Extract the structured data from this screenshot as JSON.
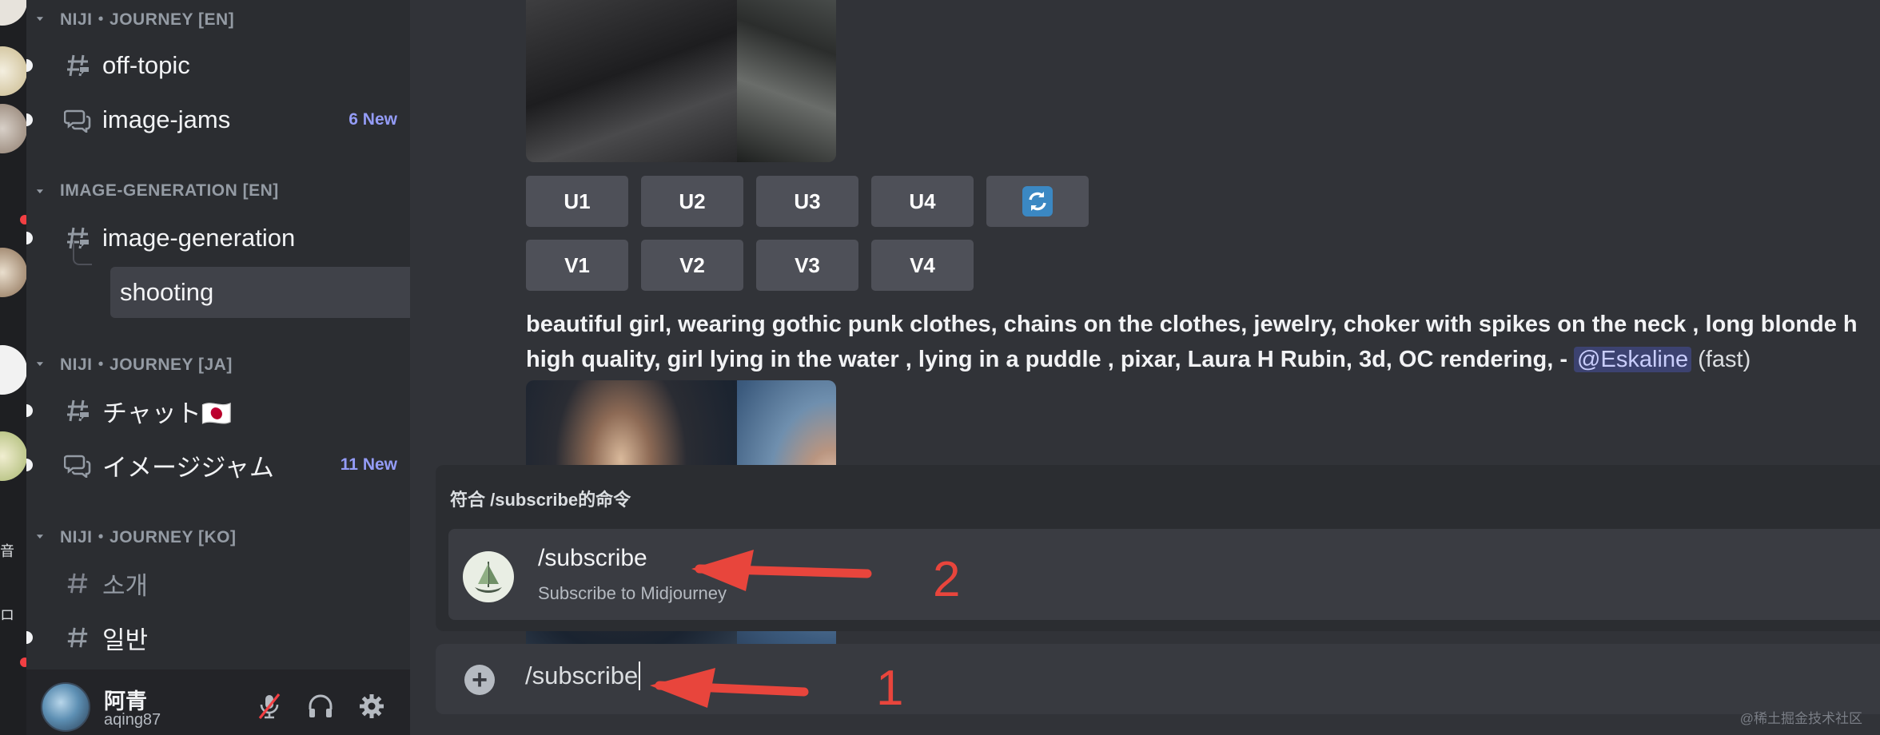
{
  "sidebar": {
    "categories": [
      {
        "label": "NIJI・JOURNEY [EN]"
      },
      {
        "label": "IMAGE-GENERATION [EN]"
      },
      {
        "label": "NIJI・JOURNEY [JA]"
      },
      {
        "label": "NIJI・JOURNEY [KO]"
      }
    ],
    "channels": [
      {
        "name": "off-topic",
        "icon": "text-channel-icon"
      },
      {
        "name": "image-jams",
        "icon": "forum-channel-icon",
        "badge": "6 New"
      },
      {
        "name": "image-generation",
        "icon": "text-channel-icon"
      },
      {
        "name": "shooting",
        "icon": "thread-icon"
      },
      {
        "name": "チャット🇯🇵",
        "icon": "text-channel-icon"
      },
      {
        "name": "イメージジャム",
        "icon": "forum-channel-icon",
        "badge": "11 New"
      },
      {
        "name": "소개",
        "icon": "text-channel-icon"
      },
      {
        "name": "일반",
        "icon": "text-channel-icon"
      }
    ]
  },
  "rail": {
    "side_text_1": "音",
    "side_text_2": "ロ"
  },
  "user": {
    "display_name": "阿青",
    "username": "aqing87"
  },
  "message": {
    "upscale_buttons": [
      "U1",
      "U2",
      "U3",
      "U4"
    ],
    "variation_buttons": [
      "V1",
      "V2",
      "V3",
      "V4"
    ],
    "reroll_icon": "refresh-icon",
    "prompt_line1": "beautiful girl, wearing gothic punk clothes, chains on the clothes, jewelry, choker with spikes on the neck , long blonde h",
    "prompt_line2": "high quality, girl lying in the water , lying in a puddle , pixar, Laura H Rubin, 3d, OC rendering, - ",
    "mention": "@Eskaline",
    "mode": "(fast)"
  },
  "command_popup": {
    "header": "符合 /subscribe的命令",
    "command": "/subscribe",
    "description": "Subscribe to Midjourney"
  },
  "input": {
    "value": "/subscribe"
  },
  "annotations": {
    "label_1": "1",
    "label_2": "2"
  },
  "watermark": "@稀土掘金技术社区",
  "colors": {
    "background": "#313338",
    "sidebar": "#2b2d31",
    "rail": "#1e1f22",
    "accent_new": "#949cf7",
    "mention_bg": "#3c4270",
    "annotation_red": "#e8453c"
  }
}
